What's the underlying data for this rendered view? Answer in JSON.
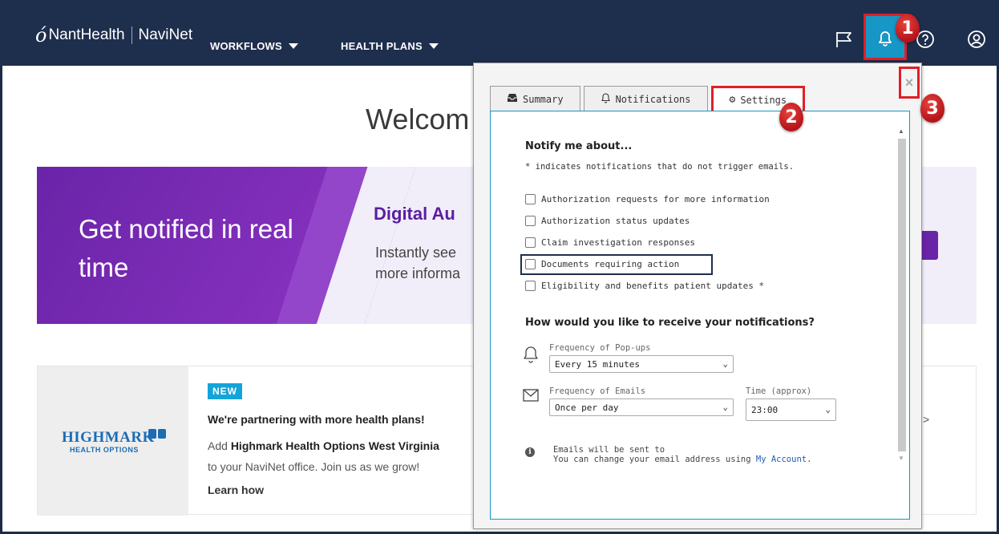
{
  "app": {
    "brand": "NantHealth",
    "product": "NaviNet"
  },
  "nav": {
    "workflows": "WORKFLOWS",
    "health_plans": "HEALTH PLANS"
  },
  "main": {
    "welcome": "Welcom",
    "promo": {
      "title": "Get notified in real time",
      "heading": "Digital Au",
      "text_line1": "Instantly see",
      "text_line2": "more informa"
    },
    "card": {
      "logo_text": "HIGHMARK",
      "logo_sub": "HEALTH OPTIONS",
      "badge": "NEW",
      "heading": "We're partnering with more health plans!",
      "text_pre": "Add ",
      "text_bold": "Highmark Health Options West Virginia",
      "text_line2": "to your NaviNet office. Join us as we grow!",
      "link": "Learn how",
      "arrow": ">"
    }
  },
  "popup": {
    "close": "×",
    "tabs": [
      {
        "label": "Summary",
        "icon": "inbox-icon"
      },
      {
        "label": "Notifications",
        "icon": "bell-icon"
      },
      {
        "label": "Settings",
        "icon": "gear-icon",
        "active": true
      }
    ],
    "notify_heading": "Notify me about...",
    "notify_note": "* indicates notifications that do not trigger emails.",
    "options": [
      "Authorization requests for more information",
      "Authorization status updates",
      "Claim investigation responses",
      "Documents requiring action",
      "Eligibility and benefits patient updates *"
    ],
    "receive_heading": "How would you like to receive your notifications?",
    "popups_label": "Frequency of Pop-ups",
    "popups_value": "Every 15 minutes",
    "emails_label": "Frequency of Emails",
    "emails_value": "Once per day",
    "time_label": "Time (approx)",
    "time_value": "23:00",
    "info_line1": "Emails will be sent to",
    "info_line2_pre": "You can change your email address using ",
    "info_link": "My Account",
    "info_line2_post": "."
  },
  "callouts": [
    "1",
    "2",
    "3"
  ],
  "colors": {
    "nav_bg": "#1e2e4d",
    "bell_active": "#1797c6",
    "highlight_red": "#e01f26",
    "promo_purple": "#6a24a8"
  }
}
